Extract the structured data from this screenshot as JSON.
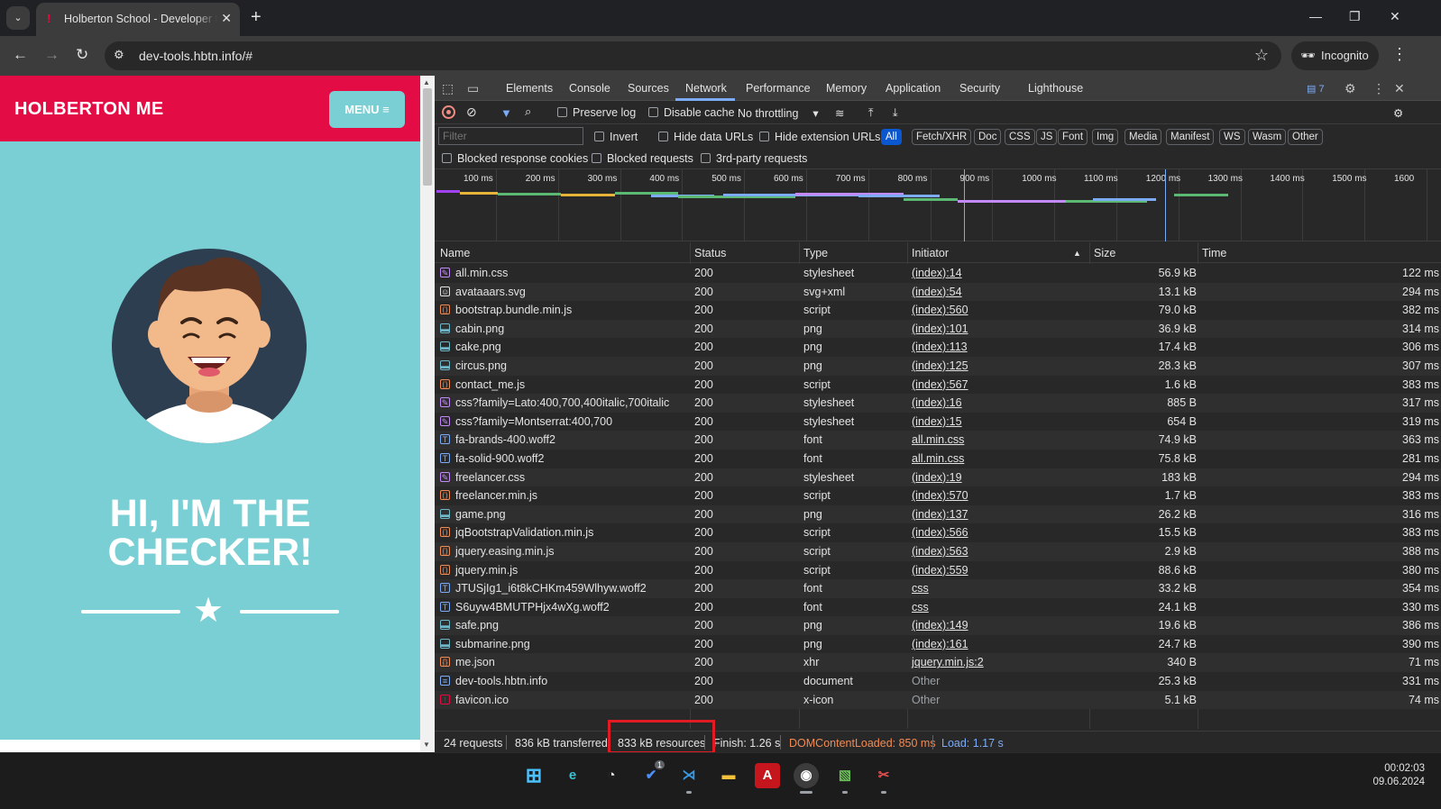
{
  "browser": {
    "tab_title": "Holberton School - Developer tools",
    "url": "dev-tools.hbtn.info/#",
    "incognito_label": "Incognito"
  },
  "page": {
    "brand": "HOLBERTON ME",
    "menu_label": "MENU",
    "hero_line1": "HI, I'M THE",
    "hero_line2": "CHECKER!"
  },
  "devtools": {
    "tabs": [
      "Elements",
      "Console",
      "Sources",
      "Network",
      "Performance",
      "Memory",
      "Application",
      "Security",
      "Lighthouse"
    ],
    "active_tab": "Network",
    "issues_count": "7",
    "toolbar": {
      "preserve_log": "Preserve log",
      "disable_cache": "Disable cache",
      "throttling": "No throttling"
    },
    "filter_placeholder": "Filter",
    "filter_options": {
      "invert": "Invert",
      "hide_data_urls": "Hide data URLs",
      "hide_extension_urls": "Hide extension URLs"
    },
    "type_filters": [
      "All",
      "Fetch/XHR",
      "Doc",
      "CSS",
      "JS",
      "Font",
      "Img",
      "Media",
      "Manifest",
      "WS",
      "Wasm",
      "Other"
    ],
    "more_options": {
      "blocked_cookies": "Blocked response cookies",
      "blocked_requests": "Blocked requests",
      "third_party": "3rd-party requests"
    },
    "timeline_labels": [
      "100 ms",
      "200 ms",
      "300 ms",
      "400 ms",
      "500 ms",
      "600 ms",
      "700 ms",
      "800 ms",
      "900 ms",
      "1000 ms",
      "1100 ms",
      "1200 ms",
      "1300 ms",
      "1400 ms",
      "1500 ms",
      "1600"
    ],
    "columns": {
      "name": "Name",
      "status": "Status",
      "type": "Type",
      "initiator": "Initiator",
      "size": "Size",
      "time": "Time"
    },
    "requests": [
      {
        "name": "all.min.css",
        "status": "200",
        "type": "stylesheet",
        "initiator": "(index):14",
        "size": "56.9 kB",
        "time": "122 ms",
        "kind": "css"
      },
      {
        "name": "avataaars.svg",
        "status": "200",
        "type": "svg+xml",
        "initiator": "(index):54",
        "size": "13.1 kB",
        "time": "294 ms",
        "kind": "svg"
      },
      {
        "name": "bootstrap.bundle.min.js",
        "status": "200",
        "type": "script",
        "initiator": "(index):560",
        "size": "79.0 kB",
        "time": "382 ms",
        "kind": "js"
      },
      {
        "name": "cabin.png",
        "status": "200",
        "type": "png",
        "initiator": "(index):101",
        "size": "36.9 kB",
        "time": "314 ms",
        "kind": "img"
      },
      {
        "name": "cake.png",
        "status": "200",
        "type": "png",
        "initiator": "(index):113",
        "size": "17.4 kB",
        "time": "306 ms",
        "kind": "img"
      },
      {
        "name": "circus.png",
        "status": "200",
        "type": "png",
        "initiator": "(index):125",
        "size": "28.3 kB",
        "time": "307 ms",
        "kind": "img"
      },
      {
        "name": "contact_me.js",
        "status": "200",
        "type": "script",
        "initiator": "(index):567",
        "size": "1.6 kB",
        "time": "383 ms",
        "kind": "js"
      },
      {
        "name": "css?family=Lato:400,700,400italic,700italic",
        "status": "200",
        "type": "stylesheet",
        "initiator": "(index):16",
        "size": "885 B",
        "time": "317 ms",
        "kind": "css"
      },
      {
        "name": "css?family=Montserrat:400,700",
        "status": "200",
        "type": "stylesheet",
        "initiator": "(index):15",
        "size": "654 B",
        "time": "319 ms",
        "kind": "css"
      },
      {
        "name": "fa-brands-400.woff2",
        "status": "200",
        "type": "font",
        "initiator": "all.min.css",
        "size": "74.9 kB",
        "time": "363 ms",
        "kind": "font"
      },
      {
        "name": "fa-solid-900.woff2",
        "status": "200",
        "type": "font",
        "initiator": "all.min.css",
        "size": "75.8 kB",
        "time": "281 ms",
        "kind": "font"
      },
      {
        "name": "freelancer.css",
        "status": "200",
        "type": "stylesheet",
        "initiator": "(index):19",
        "size": "183 kB",
        "time": "294 ms",
        "kind": "css"
      },
      {
        "name": "freelancer.min.js",
        "status": "200",
        "type": "script",
        "initiator": "(index):570",
        "size": "1.7 kB",
        "time": "383 ms",
        "kind": "js"
      },
      {
        "name": "game.png",
        "status": "200",
        "type": "png",
        "initiator": "(index):137",
        "size": "26.2 kB",
        "time": "316 ms",
        "kind": "img"
      },
      {
        "name": "jqBootstrapValidation.min.js",
        "status": "200",
        "type": "script",
        "initiator": "(index):566",
        "size": "15.5 kB",
        "time": "383 ms",
        "kind": "js"
      },
      {
        "name": "jquery.easing.min.js",
        "status": "200",
        "type": "script",
        "initiator": "(index):563",
        "size": "2.9 kB",
        "time": "388 ms",
        "kind": "js"
      },
      {
        "name": "jquery.min.js",
        "status": "200",
        "type": "script",
        "initiator": "(index):559",
        "size": "88.6 kB",
        "time": "380 ms",
        "kind": "js"
      },
      {
        "name": "JTUSjIg1_i6t8kCHKm459Wlhyw.woff2",
        "status": "200",
        "type": "font",
        "initiator": "css",
        "size": "33.2 kB",
        "time": "354 ms",
        "kind": "font"
      },
      {
        "name": "S6uyw4BMUTPHjx4wXg.woff2",
        "status": "200",
        "type": "font",
        "initiator": "css",
        "size": "24.1 kB",
        "time": "330 ms",
        "kind": "font"
      },
      {
        "name": "safe.png",
        "status": "200",
        "type": "png",
        "initiator": "(index):149",
        "size": "19.6 kB",
        "time": "386 ms",
        "kind": "img"
      },
      {
        "name": "submarine.png",
        "status": "200",
        "type": "png",
        "initiator": "(index):161",
        "size": "24.7 kB",
        "time": "390 ms",
        "kind": "img"
      },
      {
        "name": "me.json",
        "status": "200",
        "type": "xhr",
        "initiator": "jquery.min.js:2",
        "size": "340 B",
        "time": "71 ms",
        "kind": "xhr"
      },
      {
        "name": "dev-tools.hbtn.info",
        "status": "200",
        "type": "document",
        "initiator": "Other",
        "size": "25.3 kB",
        "time": "331 ms",
        "kind": "doc"
      },
      {
        "name": "favicon.ico",
        "status": "200",
        "type": "x-icon",
        "initiator": "Other",
        "size": "5.1 kB",
        "time": "74 ms",
        "kind": "ico"
      }
    ],
    "summary": {
      "requests": "24 requests",
      "transferred": "836 kB transferred",
      "resources": "833 kB resources",
      "finish": "Finish: 1.26 s",
      "dom_content_loaded": "DOMContentLoaded: 850 ms",
      "load": "Load: 1.17 s"
    }
  },
  "taskbar": {
    "time": "00:02:03",
    "date": "09.06.2024",
    "badge_count": "1"
  },
  "colors": {
    "brand_red": "#e40c44",
    "page_teal": "#7acfd4",
    "devtools_accent": "#7cacf8",
    "dcl_orange": "#f28b54",
    "load_blue": "#7cacf8",
    "highlight_red": "#e01b24"
  }
}
